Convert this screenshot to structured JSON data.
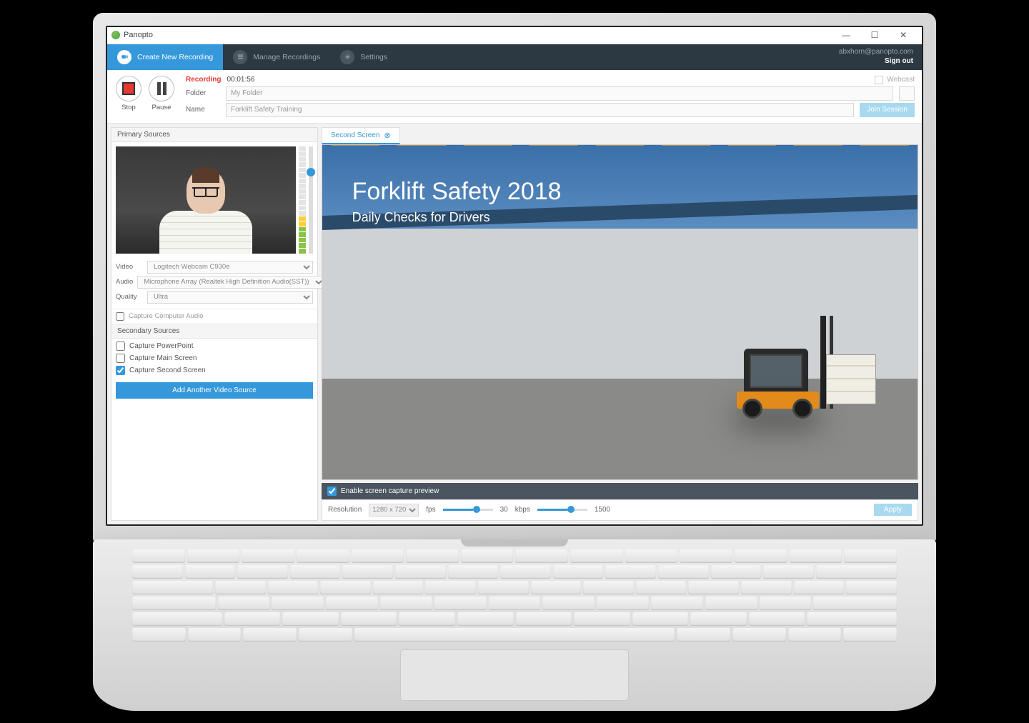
{
  "titlebar": {
    "app_name": "Panopto"
  },
  "topnav": {
    "create": "Create New Recording",
    "manage": "Manage Recordings",
    "settings": "Settings",
    "email": "abxhorn@panopto.com",
    "signout": "Sign out"
  },
  "infobar": {
    "stop": "Stop",
    "pause": "Pause",
    "recording_label": "Recording",
    "timer": "00:01:56",
    "folder_label": "Folder",
    "folder_value": "My Folder",
    "name_label": "Name",
    "name_value": "Forklift Safety Training",
    "webcast_label": "Webcast",
    "join_button": "Join Session"
  },
  "primary": {
    "header": "Primary Sources",
    "video_label": "Video",
    "video_value": "Logitech Webcam C930e",
    "audio_label": "Audio",
    "audio_value": "Microphone Array (Realtek High Definition Audio(SST))",
    "quality_label": "Quality",
    "quality_value": "Ultra",
    "capture_audio": "Capture Computer Audio"
  },
  "secondary": {
    "header": "Secondary Sources",
    "items": [
      {
        "label": "Capture PowerPoint",
        "checked": false
      },
      {
        "label": "Capture Main Screen",
        "checked": false
      },
      {
        "label": "Capture Second Screen",
        "checked": true
      }
    ],
    "add_button": "Add Another Video Source"
  },
  "preview": {
    "tab_label": "Second Screen",
    "slide_title": "Forklift Safety 2018",
    "slide_subtitle": "Daily Checks for Drivers",
    "enable_preview": "Enable screen capture preview"
  },
  "settings_bar": {
    "resolution_label": "Resolution",
    "resolution_value": "1280 x 720",
    "fps_label": "fps",
    "fps_value": "30",
    "kbps_label": "kbps",
    "kbps_value": "1500",
    "apply": "Apply"
  }
}
